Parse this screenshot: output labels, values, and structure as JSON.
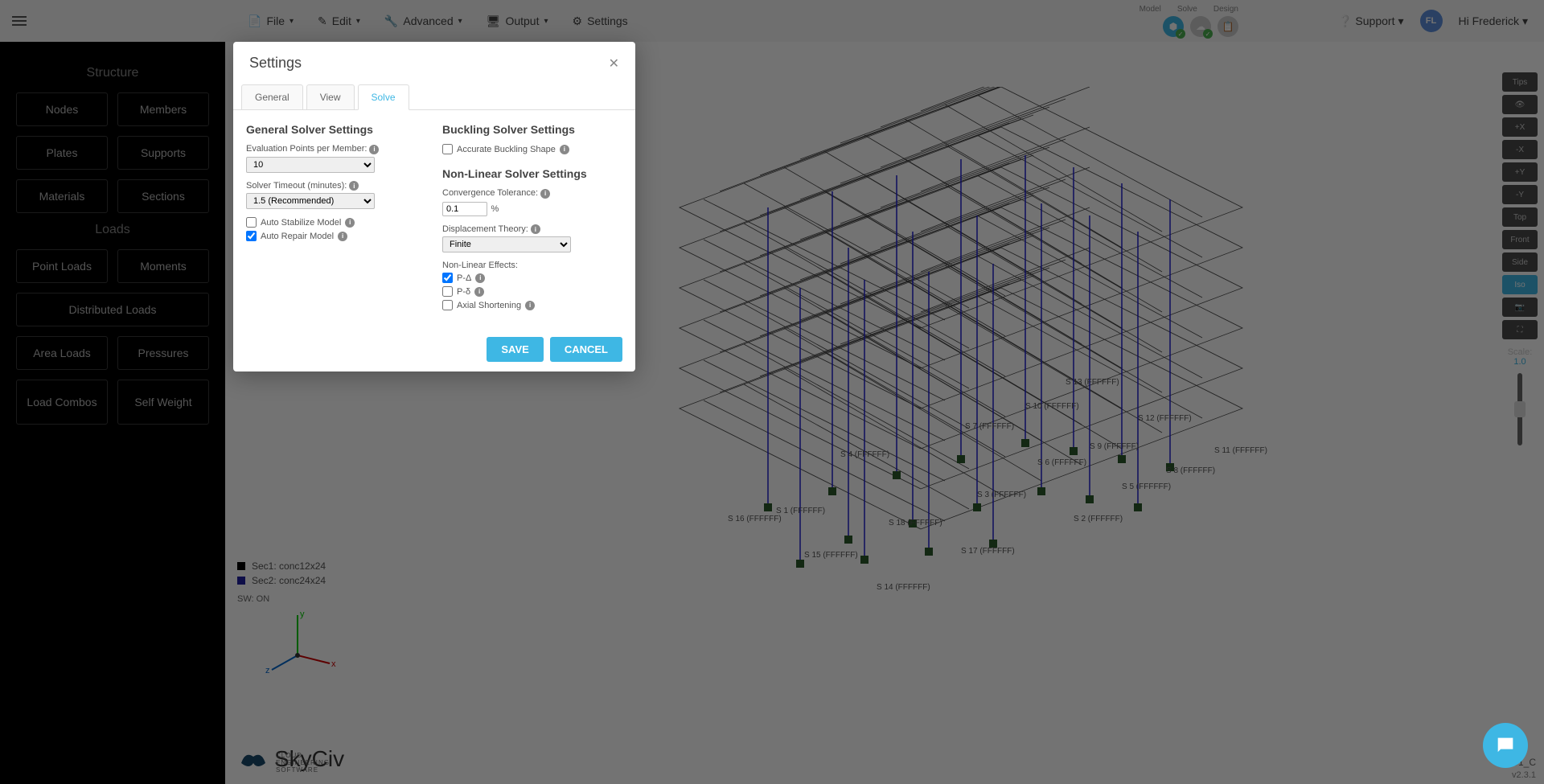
{
  "topbar": {
    "menu": {
      "file": "File",
      "edit": "Edit",
      "advanced": "Advanced",
      "output": "Output",
      "settings": "Settings"
    },
    "modes": {
      "model": "Model",
      "solve": "Solve",
      "design": "Design"
    },
    "support": "Support",
    "user_initials": "FL",
    "user_greeting": "Hi  Frederick"
  },
  "sidebar": {
    "structure": {
      "title": "Structure",
      "nodes": "Nodes",
      "members": "Members",
      "plates": "Plates",
      "supports": "Supports",
      "materials": "Materials",
      "sections": "Sections"
    },
    "loads": {
      "title": "Loads",
      "point_loads": "Point Loads",
      "moments": "Moments",
      "distributed_loads": "Distributed Loads",
      "area_loads": "Area Loads",
      "pressures": "Pressures",
      "load_combos": "Load Combos",
      "self_weight": "Self Weight"
    }
  },
  "legend": {
    "sec1": "Sec1: conc12x24",
    "sec2": "Sec2: conc24x24",
    "sw": "SW: ON"
  },
  "logo": {
    "name": "SkyCiv",
    "sub": "CLOUD ENGINEERING SOFTWARE"
  },
  "view_controls": {
    "tips": "Tips",
    "eye": "👁",
    "px": "+X",
    "mx": "-X",
    "py": "+Y",
    "my": "-Y",
    "top": "Top",
    "front": "Front",
    "side": "Side",
    "iso": "Iso",
    "camera": "📷",
    "expand": "⛶",
    "scale_label": "Scale:",
    "scale_value": "1.0"
  },
  "modal": {
    "title": "Settings",
    "tabs": {
      "general": "General",
      "view": "View",
      "solve": "Solve"
    },
    "general_solver": {
      "heading": "General Solver Settings",
      "eval_label": "Evaluation Points per Member:",
      "eval_value": "10",
      "timeout_label": "Solver Timeout (minutes):",
      "timeout_value": "1.5 (Recommended)",
      "auto_stabilize": "Auto Stabilize Model",
      "auto_repair": "Auto Repair Model"
    },
    "buckling": {
      "heading": "Buckling Solver Settings",
      "accurate": "Accurate Buckling Shape"
    },
    "nonlinear": {
      "heading": "Non-Linear Solver Settings",
      "conv_label": "Convergence Tolerance:",
      "conv_value": "0.1",
      "conv_unit": "%",
      "disp_label": "Displacement Theory:",
      "disp_value": "Finite",
      "effects_label": "Non-Linear Effects:",
      "p_delta_cap": "P-Δ",
      "p_delta_low": "P-δ",
      "axial": "Axial Shortening"
    },
    "buttons": {
      "save": "SAVE",
      "cancel": "CANCEL"
    }
  },
  "footer": {
    "version": "v2.3.1",
    "id": "64D1_C"
  },
  "model_labels": [
    "S 1 (FFFFFF)",
    "S 2 (FFFFFF)",
    "S 3 (FFFFFF)",
    "S 4 (FFFFFF)",
    "S 5 (FFFFFF)",
    "S 6 (FFFFFF)",
    "S 7 (FFFFFF)",
    "S 8 (FFFFFF)",
    "S 9 (FFFFFF)",
    "S 10 (FFFFFF)",
    "S 11 (FFFFFF)",
    "S 12 (FFFFFF)",
    "S 13 (FFFFFF)",
    "S 14 (FFFFFF)",
    "S 15 (FFFFFF)",
    "S 16 (FFFFFF)",
    "S 17 (FFFFFF)",
    "S 18 (FFFFFF)"
  ]
}
